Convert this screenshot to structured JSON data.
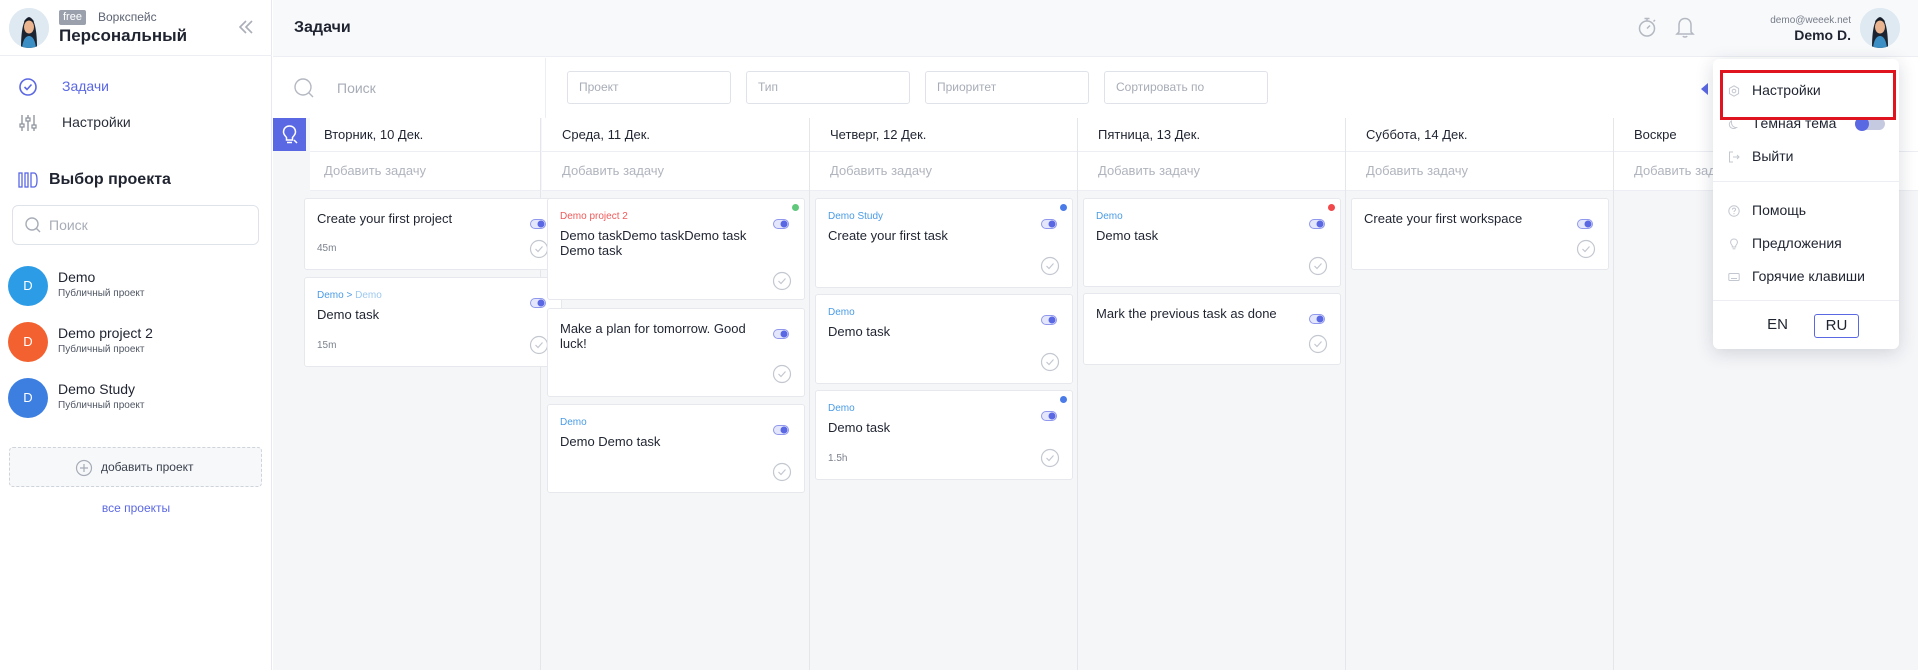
{
  "workspace": {
    "badge": "free",
    "caption": "Воркспейс",
    "name": "Персональный"
  },
  "sidebar": {
    "nav": [
      {
        "label": "Задачи",
        "icon": "check-circle-icon"
      },
      {
        "label": "Настройки",
        "icon": "sliders-icon"
      }
    ],
    "projects_title": "Выбор проекта",
    "search_placeholder": "Поиск",
    "projects": [
      {
        "initial": "D",
        "name": "Demo",
        "subtitle": "Публичный проект",
        "color": "#2d9ce6"
      },
      {
        "initial": "D",
        "name": "Demo project 2",
        "subtitle": "Публичный проект",
        "color": "#f2612f"
      },
      {
        "initial": "D",
        "name": "Demo Study",
        "subtitle": "Публичный проект",
        "color": "#3c7fe0"
      }
    ],
    "add_project": "добавить проект",
    "all_projects": "все проекты"
  },
  "topbar": {
    "title": "Задачи",
    "user_email": "demo@weeek.net",
    "user_name": "Demo D."
  },
  "filters": {
    "search_placeholder": "Поиск",
    "project": "Проект",
    "type": "Тип",
    "priority": "Приоритет",
    "sort": "Сортировать по"
  },
  "board": {
    "add_task": "Добавить задачу",
    "columns": [
      {
        "date": "Вторник, 10 Дек.",
        "cards": [
          {
            "project": "",
            "title": "Create your first project",
            "duration": "45m",
            "dot": "#f0484b"
          },
          {
            "project": "Demo",
            "project_sub": "Demo",
            "title": "Demo task",
            "duration": "15m",
            "dot": "#5fc87a"
          }
        ]
      },
      {
        "date": "Среда, 11 Дек.",
        "cards": [
          {
            "project": "Demo project 2",
            "title": "Demo taskDemo taskDemo task Demo task",
            "duration": "",
            "dot": "#5fc87a"
          },
          {
            "project": "",
            "title": "Make a plan for tomorrow. Good luck!",
            "duration": "",
            "dot": ""
          },
          {
            "project": "Demo",
            "title": "Demo Demo task",
            "duration": "",
            "dot": ""
          }
        ]
      },
      {
        "date": "Четверг, 12 Дек.",
        "cards": [
          {
            "project": "Demo Study",
            "title": "Create your first task",
            "duration": "",
            "dot": "#4a7be8"
          },
          {
            "project": "Demo",
            "title": "Demo task",
            "duration": "",
            "dot": ""
          },
          {
            "project": "Demo",
            "title": "Demo task",
            "duration": "1.5h",
            "dot": "#4a7be8"
          }
        ]
      },
      {
        "date": "Пятница, 13 Дек.",
        "cards": [
          {
            "project": "Demo",
            "title": "Demo task",
            "duration": "",
            "dot": "#f0484b"
          },
          {
            "project": "",
            "title": "Mark the previous task as done",
            "duration": "",
            "dot": ""
          }
        ]
      },
      {
        "date": "Суббота, 14 Дек.",
        "cards": [
          {
            "project": "",
            "title": "Create your first workspace",
            "duration": "",
            "dot": ""
          }
        ]
      },
      {
        "date": "Воскре",
        "cards": []
      }
    ]
  },
  "menu": {
    "items": [
      {
        "label": "Настройки",
        "icon": "hexagon-icon"
      },
      {
        "label": "Тёмная тема",
        "icon": "moon-icon",
        "toggle": true,
        "toggle_on": true
      },
      {
        "label": "Выйти",
        "icon": "logout-icon"
      },
      {
        "label": "Помощь",
        "icon": "help-icon"
      },
      {
        "label": "Предложения",
        "icon": "bulb-icon"
      },
      {
        "label": "Горячие клавиши",
        "icon": "keyboard-icon"
      }
    ],
    "languages": [
      "EN",
      "RU"
    ],
    "active_language": "RU"
  },
  "colors": {
    "accent": "#5b68e3",
    "highlight": "#e0141e",
    "project_link": "#4a9be6",
    "project_red": "#f05a5a"
  }
}
